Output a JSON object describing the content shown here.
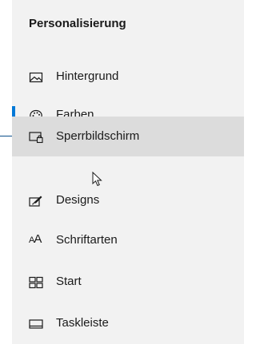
{
  "panel": {
    "title": "Personalisierung",
    "items": [
      {
        "label": "Hintergrund",
        "icon": "picture-icon"
      },
      {
        "label": "Farben",
        "icon": "palette-icon",
        "selected": true
      },
      {
        "label": "Sperrbildschirm",
        "icon": "lock-screen-icon",
        "hovered": true
      },
      {
        "label": "Designs",
        "icon": "designs-icon"
      },
      {
        "label": "Schriftarten",
        "icon": "fonts-icon",
        "glyph": "AA"
      },
      {
        "label": "Start",
        "icon": "start-icon"
      },
      {
        "label": "Taskleiste",
        "icon": "taskbar-icon"
      }
    ]
  },
  "colors": {
    "accent": "#0078d7",
    "hover_background": "#dcdcdc",
    "panel_background": "#f2f2f2",
    "callout": "#0a4f8a"
  }
}
